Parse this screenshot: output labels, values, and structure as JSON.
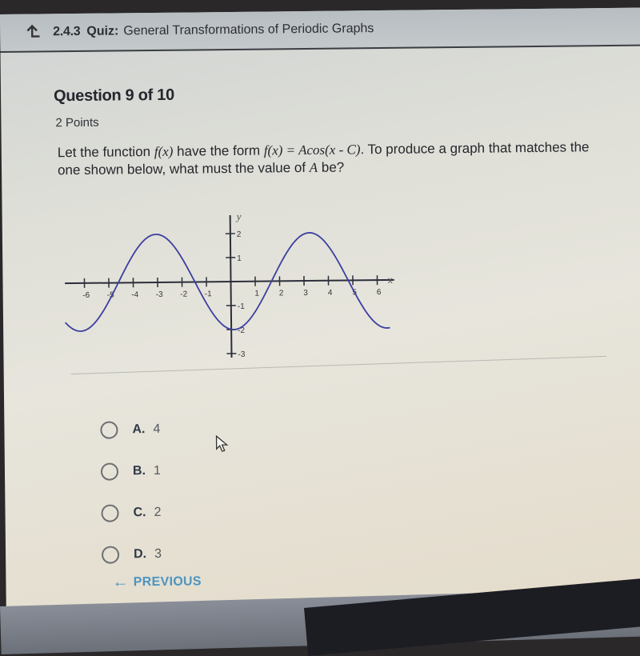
{
  "header": {
    "back_icon": "↵",
    "quiz_number": "2.4.3",
    "quiz_type": "Quiz:",
    "quiz_title": "General Transformations of Periodic Graphs"
  },
  "question": {
    "title": "Question 9 of 10",
    "points": "2 Points",
    "text_part1": "Let the function ",
    "fx1": "f(x)",
    "text_part2": " have the form ",
    "fx2": "f(x) = Acos(x - C)",
    "text_part3": ". To produce a graph that matches the one shown below, what must the value of ",
    "var_a": "A",
    "text_part4": " be?"
  },
  "chart_data": {
    "type": "line",
    "title": "",
    "xlabel": "x",
    "ylabel": "y",
    "xlim": [
      -6.8,
      6.5
    ],
    "ylim": [
      -3.3,
      2.5
    ],
    "x_ticks": [
      -6,
      -5,
      -4,
      -3,
      -2,
      -1,
      1,
      2,
      3,
      4,
      5,
      6
    ],
    "x_tick_labels": [
      "-6",
      "-5",
      "-4",
      "-3",
      "-2",
      "-1",
      "1",
      "2",
      "3",
      "4",
      "5",
      "6"
    ],
    "y_ticks": [
      2,
      1,
      -1,
      -2,
      -3
    ],
    "y_tick_labels": [
      "2",
      "1",
      "-1",
      "-2",
      "-3"
    ],
    "series": [
      {
        "name": "f(x)",
        "color": "#3a3fa0",
        "function": "-2*cos(x - 0.1)",
        "amplitude": 2,
        "min_point": [
          0.1,
          -2
        ],
        "max_points": [
          [
            -3.4,
            2
          ],
          [
            2.9,
            2
          ]
        ],
        "x_intercepts": [
          -4.9,
          -1.8,
          1.4,
          4.6
        ]
      }
    ],
    "grid": false
  },
  "choices": [
    {
      "letter": "A.",
      "value": "4"
    },
    {
      "letter": "B.",
      "value": "1"
    },
    {
      "letter": "C.",
      "value": "2"
    },
    {
      "letter": "D.",
      "value": "3"
    }
  ],
  "nav": {
    "previous_arrow": "←",
    "previous_label": "PREVIOUS"
  }
}
